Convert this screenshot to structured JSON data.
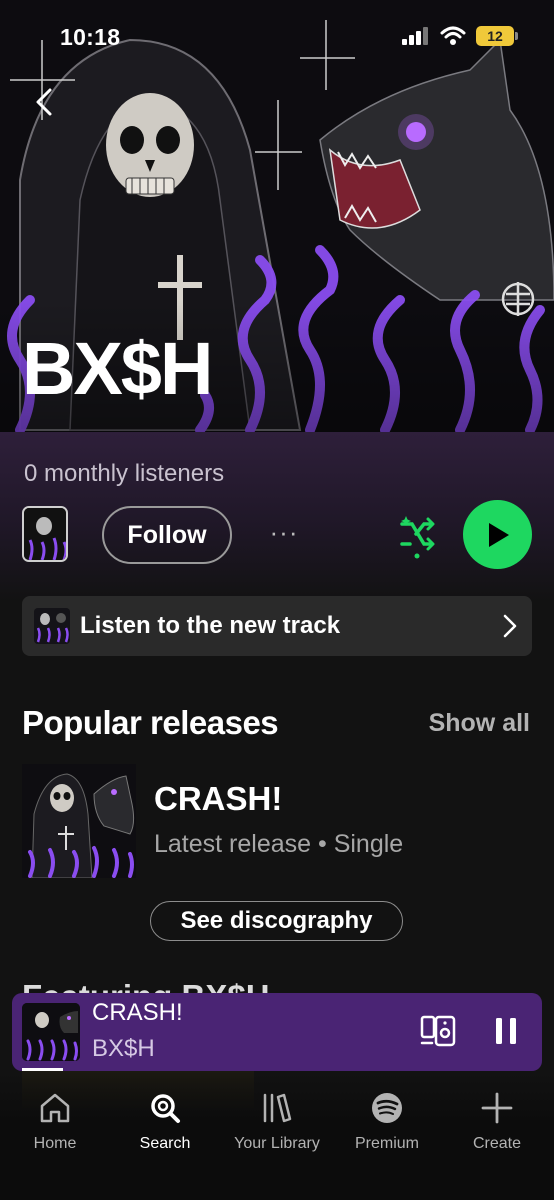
{
  "status_bar": {
    "time": "10:18",
    "battery": "12"
  },
  "artist": {
    "name": "BX$H",
    "monthly_listeners": "0 monthly listeners",
    "follow_label": "Follow",
    "more_label": "···"
  },
  "new_track": {
    "label": "Listen to the new track"
  },
  "popular_releases": {
    "title": "Popular releases",
    "show_all": "Show all",
    "items": [
      {
        "title": "CRASH!",
        "meta": "Latest release • Single"
      }
    ],
    "discography_label": "See discography"
  },
  "featuring": {
    "title": "Featuring BX$H"
  },
  "now_playing": {
    "title": "CRASH!",
    "artist": "BX$H",
    "progress": 0.08
  },
  "nav": [
    {
      "label": "Home",
      "icon": "home-icon"
    },
    {
      "label": "Search",
      "icon": "search-icon",
      "active": true
    },
    {
      "label": "Your Library",
      "icon": "library-icon"
    },
    {
      "label": "Premium",
      "icon": "spotify-icon"
    },
    {
      "label": "Create",
      "icon": "plus-icon"
    }
  ],
  "colors": {
    "accent": "#1ed760",
    "now_playing_bg": "#4a2474",
    "flame": "#8a4df0"
  }
}
